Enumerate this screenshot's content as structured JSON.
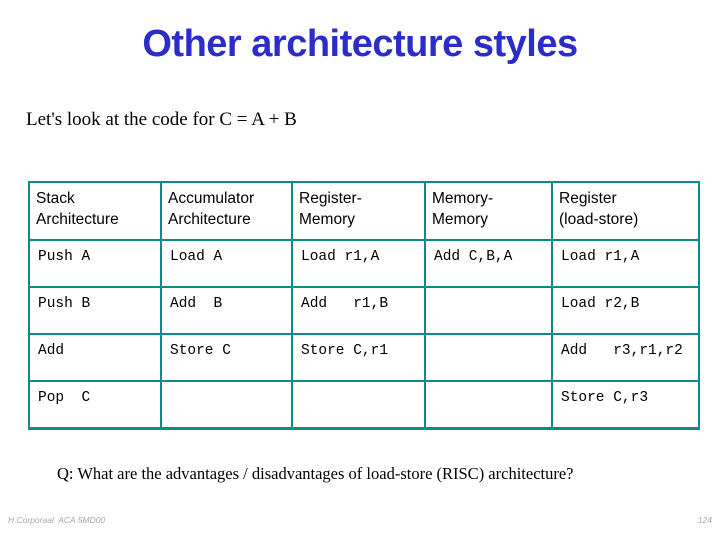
{
  "slide": {
    "title": "Other architecture styles",
    "title_color": "#2c2ccb",
    "subtitle": "Let's look at the code for C = A + B",
    "question": "Q: What are the advantages / disadvantages of load-store (RISC) architecture?"
  },
  "table": {
    "border_color": "#0d8b8b",
    "headers": [
      {
        "line1": "Stack",
        "line2": "Architecture"
      },
      {
        "line1": "Accumulator",
        "line2": "Architecture"
      },
      {
        "line1": "Register-",
        "line2": "Memory"
      },
      {
        "line1": "Memory-",
        "line2": "Memory"
      },
      {
        "line1": "Register",
        "line2": "(load-store)"
      }
    ],
    "rows": [
      {
        "stack": "Push A",
        "accumulator": "Load A",
        "register_memory": "Load r1,A",
        "memory_memory": "Add C,B,A",
        "register_load_store": "Load r1,A"
      },
      {
        "stack": "Push B",
        "accumulator": "Add  B",
        "register_memory": "Add   r1,B",
        "memory_memory": "",
        "register_load_store": "Load r2,B"
      },
      {
        "stack": "Add",
        "accumulator": "Store C",
        "register_memory": "Store C,r1",
        "memory_memory": "",
        "register_load_store": "Add   r3,r1,r2"
      },
      {
        "stack": "Pop  C",
        "accumulator": "",
        "register_memory": "",
        "memory_memory": "",
        "register_load_store": "Store C,r3"
      }
    ]
  },
  "footer": {
    "author": "H.Corporaal  ACA 5MD00",
    "page": "124"
  }
}
